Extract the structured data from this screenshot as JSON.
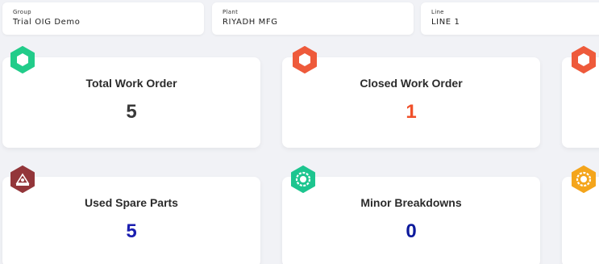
{
  "filters": {
    "group": {
      "label": "Group",
      "value": "Trial OIG Demo"
    },
    "plant": {
      "label": "Plant",
      "value": "RIYADH MFG"
    },
    "line": {
      "label": "Line",
      "value": "LINE 1"
    }
  },
  "cards": {
    "total_work_order": {
      "title": "Total Work Order",
      "value": "5",
      "value_color": "#3a3a3a",
      "icon": "hexagon-ring-icon",
      "icon_color": "#22cc8a"
    },
    "closed_work_order": {
      "title": "Closed Work Order",
      "value": "1",
      "value_color": "#f0502a",
      "icon": "hexagon-ring-icon",
      "icon_color": "#ee5a3b"
    },
    "right_top": {
      "icon": "hexagon-ring-icon",
      "icon_color": "#ee5a3b"
    },
    "used_spare_parts": {
      "title": "Used Spare Parts",
      "value": "5",
      "value_color": "#1b1fb0",
      "icon": "spare-parts-icon",
      "icon_color": "#93363a"
    },
    "minor_breakdowns": {
      "title": "Minor Breakdowns",
      "value": "0",
      "value_color": "#0d1a9c",
      "icon": "gear-settings-icon",
      "icon_color": "#1dc58f"
    },
    "right_bottom": {
      "icon": "gear-settings-icon",
      "icon_color": "#f4a51c"
    }
  }
}
